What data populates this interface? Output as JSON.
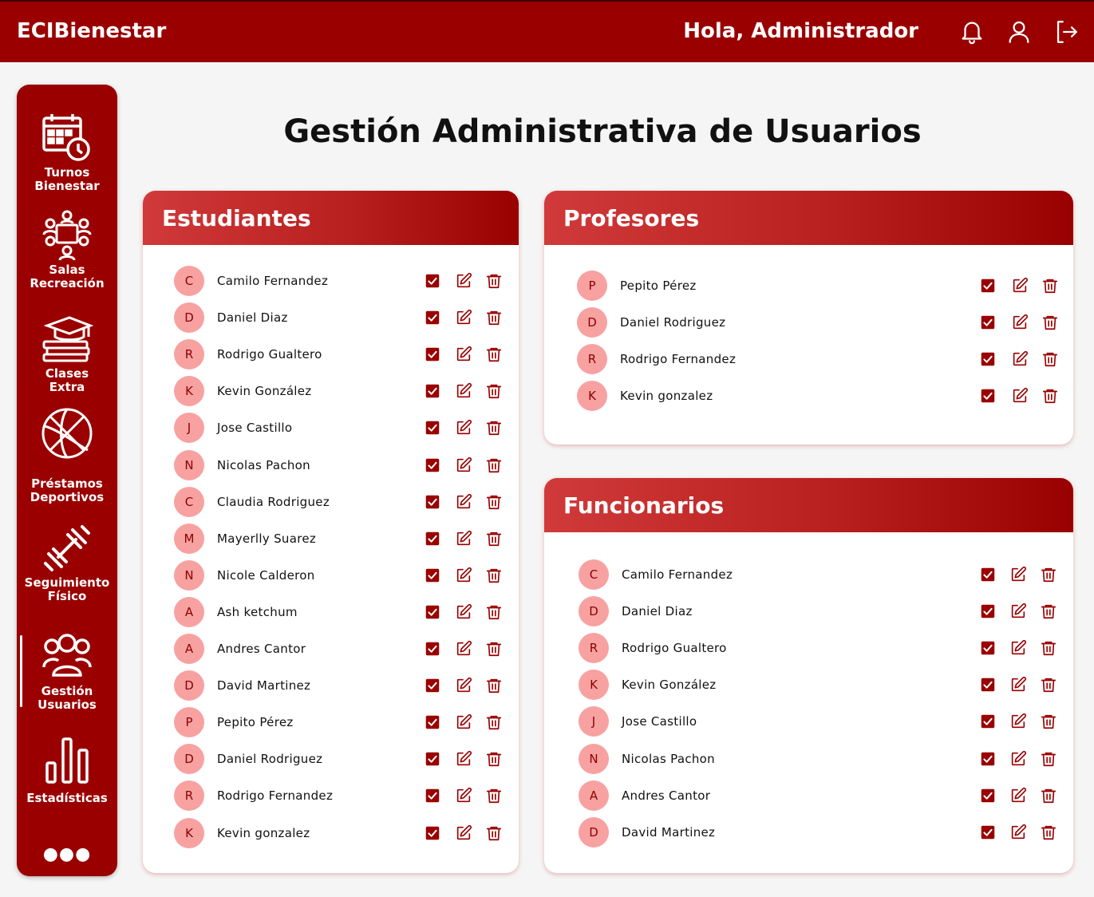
{
  "header": {
    "brand": "ECIBienestar",
    "greeting": "Hola, Administrador",
    "icons": [
      "bell-icon",
      "user-icon",
      "logout-icon"
    ]
  },
  "sidebar": {
    "items": [
      {
        "label": "Turnos\nBienestar",
        "icon": "calendar-clock-icon"
      },
      {
        "label": "Salas\nRecreación",
        "icon": "meeting-room-icon"
      },
      {
        "label": "Clases\nExtra",
        "icon": "graduation-books-icon"
      },
      {
        "label": "Préstamos\nDeportivos",
        "icon": "basketball-icon"
      },
      {
        "label": "Seguimiento\nFísico",
        "icon": "dumbbell-icon"
      },
      {
        "label": "Gestión\nUsuarios",
        "icon": "users-group-icon",
        "active": true
      },
      {
        "label": "Estadísticas",
        "icon": "bar-chart-icon"
      }
    ],
    "more": "●●●"
  },
  "page_title": "Gestión Administrativa de Usuarios",
  "colors": {
    "primary": "#9a0000",
    "avatar_bg": "#f8a1a1",
    "background": "#f5f5f5"
  },
  "estudiantes": {
    "title": "Estudiantes",
    "users": [
      {
        "initial": "C",
        "name": "Camilo Fernandez"
      },
      {
        "initial": "D",
        "name": "Daniel Diaz"
      },
      {
        "initial": "R",
        "name": "Rodrigo Gualtero"
      },
      {
        "initial": "K",
        "name": "Kevin González"
      },
      {
        "initial": "J",
        "name": "Jose Castillo"
      },
      {
        "initial": "N",
        "name": "Nicolas Pachon"
      },
      {
        "initial": "C",
        "name": "Claudia Rodriguez"
      },
      {
        "initial": "M",
        "name": "Mayerlly Suarez"
      },
      {
        "initial": "N",
        "name": "Nicole Calderon"
      },
      {
        "initial": "A",
        "name": "Ash ketchum"
      },
      {
        "initial": "A",
        "name": "Andres Cantor"
      },
      {
        "initial": "D",
        "name": "David Martinez"
      },
      {
        "initial": "P",
        "name": "Pepito Pérez"
      },
      {
        "initial": "D",
        "name": "Daniel Rodriguez"
      },
      {
        "initial": "R",
        "name": "Rodrigo Fernandez"
      },
      {
        "initial": "K",
        "name": "Kevin gonzalez"
      }
    ]
  },
  "profesores": {
    "title": "Profesores",
    "users": [
      {
        "initial": "P",
        "name": "Pepito Pérez"
      },
      {
        "initial": "D",
        "name": "Daniel Rodriguez"
      },
      {
        "initial": "R",
        "name": "Rodrigo Fernandez"
      },
      {
        "initial": "K",
        "name": "Kevin gonzalez"
      }
    ]
  },
  "funcionarios": {
    "title": "Funcionarios",
    "users": [
      {
        "initial": "C",
        "name": "Camilo Fernandez"
      },
      {
        "initial": "D",
        "name": "Daniel Diaz"
      },
      {
        "initial": "R",
        "name": "Rodrigo Gualtero"
      },
      {
        "initial": "K",
        "name": "Kevin González"
      },
      {
        "initial": "J",
        "name": "Jose Castillo"
      },
      {
        "initial": "N",
        "name": "Nicolas Pachon"
      },
      {
        "initial": "A",
        "name": "Andres Cantor"
      },
      {
        "initial": "D",
        "name": "David Martinez"
      }
    ]
  }
}
